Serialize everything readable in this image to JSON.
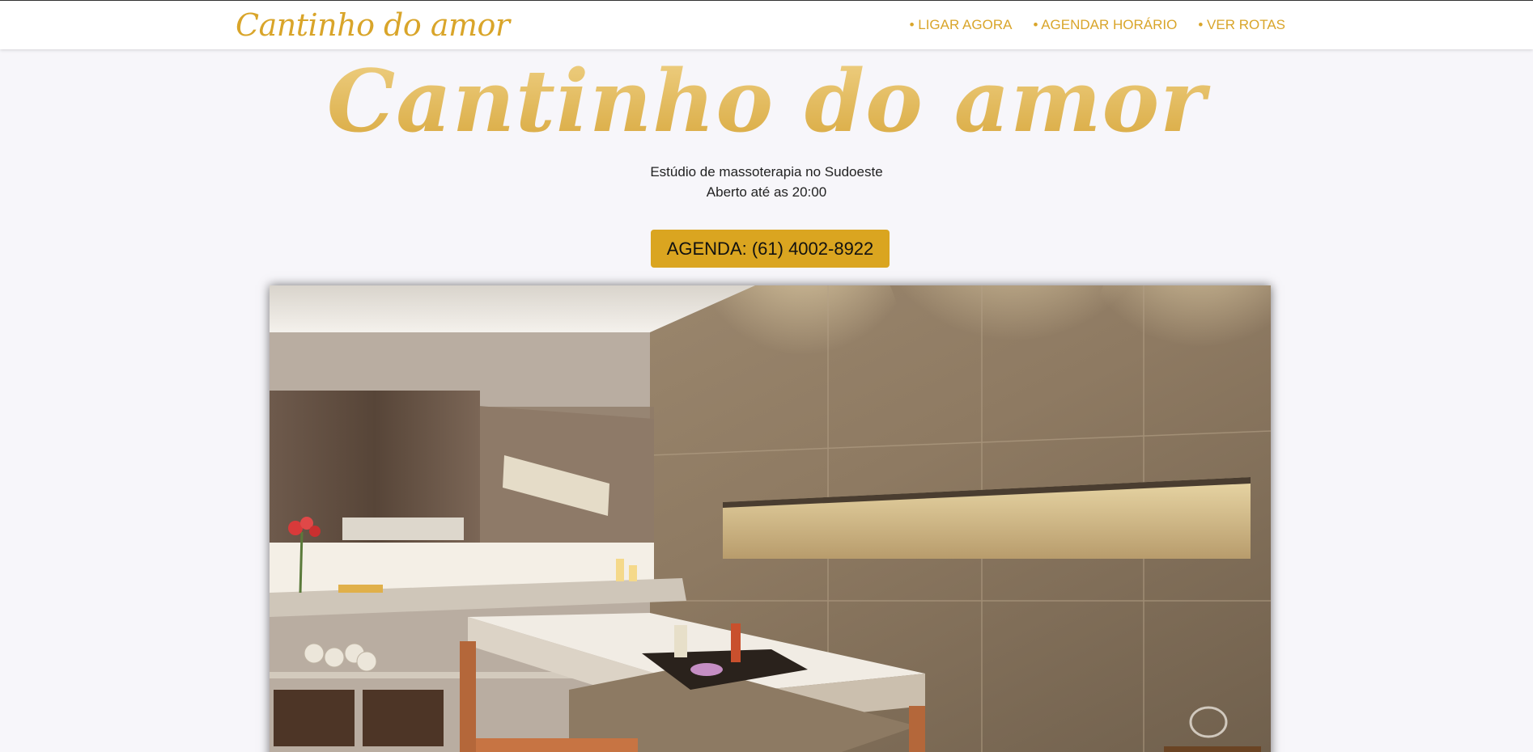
{
  "navbar": {
    "logo": "Cantinho do amor",
    "links": [
      {
        "label": "• LIGAR AGORA"
      },
      {
        "label": "• AGENDAR HORÁRIO"
      },
      {
        "label": "• VER ROTAS"
      }
    ]
  },
  "hero": {
    "title": "Cantinho do amor",
    "subtitle_line1": "Estúdio de massoterapia no Sudoeste",
    "subtitle_line2": "Aberto até as 20:00",
    "cta_label": "AGENDA: (61) 4002-8922"
  },
  "colors": {
    "brand_gold": "#daa520",
    "background": "#f7f6fa"
  },
  "icons": []
}
